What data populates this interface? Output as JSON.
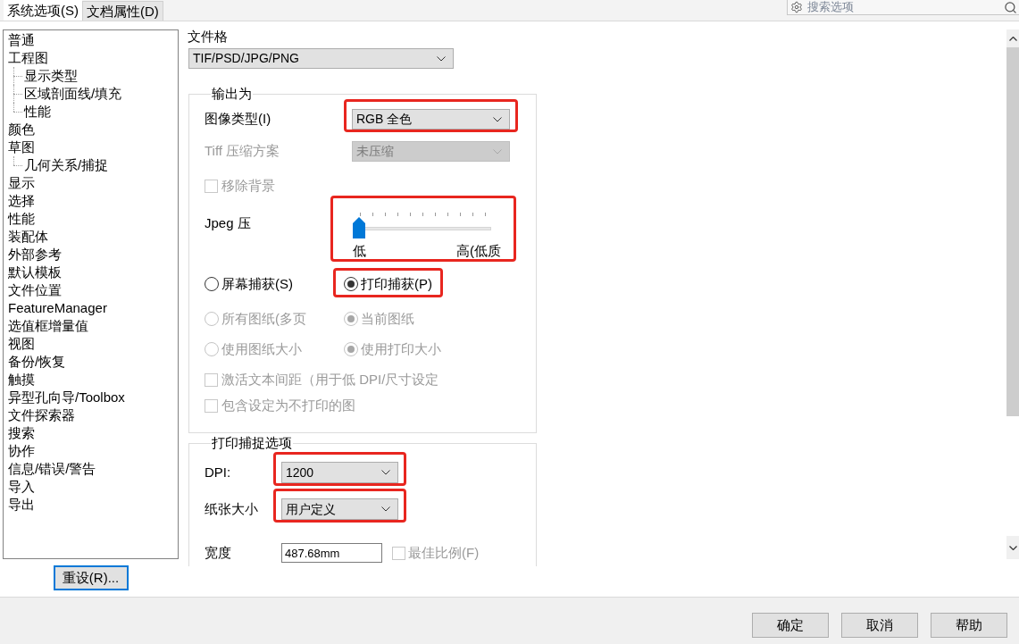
{
  "tabs": [
    {
      "label": "系统选项(S)",
      "selected": true
    },
    {
      "label": "文档属性(D)",
      "selected": false
    }
  ],
  "search": {
    "placeholder": "搜索选项"
  },
  "sidebar": {
    "items": [
      {
        "label": "普通"
      },
      {
        "label": "工程图",
        "children": [
          {
            "label": "显示类型"
          },
          {
            "label": "区域剖面线/填充"
          },
          {
            "label": "性能"
          }
        ]
      },
      {
        "label": "颜色"
      },
      {
        "label": "草图",
        "children": [
          {
            "label": "几何关系/捕捉"
          }
        ]
      },
      {
        "label": "显示"
      },
      {
        "label": "选择"
      },
      {
        "label": "性能"
      },
      {
        "label": "装配体"
      },
      {
        "label": "外部参考"
      },
      {
        "label": "默认模板"
      },
      {
        "label": "文件位置"
      },
      {
        "label": "FeatureManager"
      },
      {
        "label": "选值框增量值"
      },
      {
        "label": "视图"
      },
      {
        "label": "备份/恢复"
      },
      {
        "label": "触摸"
      },
      {
        "label": "异型孔向导/Toolbox"
      },
      {
        "label": "文件探索器"
      },
      {
        "label": "搜索"
      },
      {
        "label": "协作"
      },
      {
        "label": "信息/错误/警告"
      },
      {
        "label": "导入"
      },
      {
        "label": "导出"
      }
    ]
  },
  "reset_button": "重设(R)...",
  "file_format": {
    "label": "文件格",
    "value": "TIF/PSD/JPG/PNG"
  },
  "output_group": {
    "title": "输出为",
    "rows": [
      {
        "kind": "dropdown",
        "label": "图像类型(I)",
        "value": "RGB 全色",
        "disabled": false,
        "highlighted": true
      },
      {
        "kind": "dropdown",
        "label": "Tiff 压缩方案",
        "value": "未压缩",
        "disabled": true,
        "highlighted": false
      },
      {
        "kind": "checkbox",
        "label": "移除背景",
        "checked": false,
        "disabled": true,
        "highlighted": false
      },
      {
        "kind": "slider",
        "label": "Jpeg 压",
        "level": 0,
        "min_label": "低",
        "max_label": "高(低质",
        "highlighted": true
      },
      {
        "kind": "radio_pair",
        "options": [
          {
            "label": "屏幕捕获(S)",
            "selected": false,
            "disabled": false,
            "highlighted": false
          },
          {
            "label": "打印捕获(P)",
            "selected": true,
            "disabled": false,
            "highlighted": true
          }
        ]
      },
      {
        "kind": "radio_pair",
        "options": [
          {
            "label": "所有图纸(多页",
            "selected": false,
            "disabled": true,
            "highlighted": false
          },
          {
            "label": "当前图纸",
            "selected": true,
            "disabled": true,
            "highlighted": false
          }
        ]
      },
      {
        "kind": "radio_pair",
        "options": [
          {
            "label": "使用图纸大小",
            "selected": false,
            "disabled": true,
            "highlighted": false
          },
          {
            "label": "使用打印大小",
            "selected": true,
            "disabled": true,
            "highlighted": false
          }
        ]
      },
      {
        "kind": "checkbox",
        "label": "激活文本间距（用于低 DPI/尺寸设定",
        "checked": false,
        "disabled": true,
        "highlighted": false
      },
      {
        "kind": "checkbox",
        "label": "包含设定为不打印的图",
        "checked": false,
        "disabled": true,
        "highlighted": false
      }
    ]
  },
  "print_group": {
    "title": "打印捕捉选项",
    "rows": [
      {
        "kind": "dropdown",
        "label": "DPI:",
        "value": "1200",
        "disabled": false,
        "highlighted": true
      },
      {
        "kind": "dropdown",
        "label": "纸张大小",
        "value": "用户定义",
        "disabled": false,
        "highlighted": true
      },
      {
        "kind": "input",
        "label": "宽度",
        "value": "487.68mm",
        "highlighted": false,
        "option": {
          "label": "最佳比例(F)",
          "checked": false,
          "disabled": true
        }
      }
    ]
  },
  "buttons": [
    "确定",
    "取消",
    "帮助"
  ]
}
